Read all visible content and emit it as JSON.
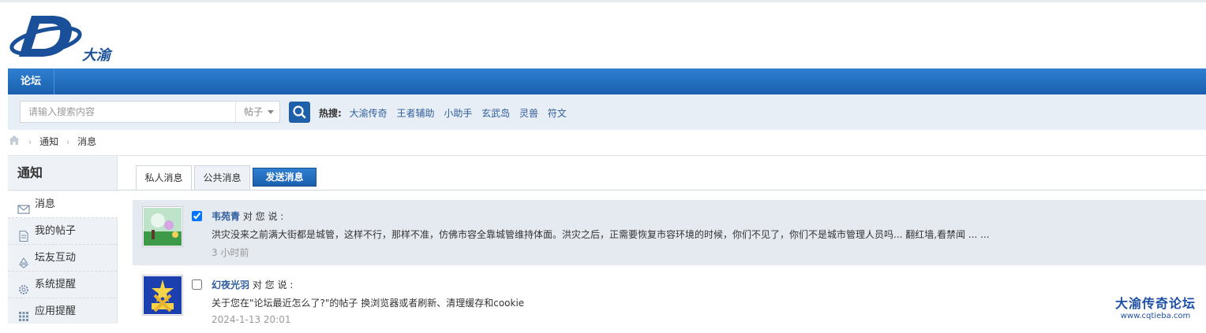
{
  "site": {
    "logo_text": "大渝"
  },
  "nav": {
    "items": [
      {
        "label": "论坛"
      }
    ]
  },
  "search": {
    "placeholder": "请输入搜索内容",
    "type_selected": "帖子",
    "hot_label": "热搜:",
    "hot_terms": [
      "大渝传奇",
      "王者辅助",
      "小助手",
      "玄武岛",
      "灵兽",
      "符文"
    ]
  },
  "breadcrumb": {
    "items": [
      "通知",
      "消息"
    ]
  },
  "sidebar": {
    "title": "通知",
    "items": [
      {
        "label": "消息",
        "icon": "envelope-icon",
        "active": true
      },
      {
        "label": "我的帖子",
        "icon": "document-icon"
      },
      {
        "label": "坛友互动",
        "icon": "recycle-icon"
      },
      {
        "label": "系统提醒",
        "icon": "gear-icon"
      },
      {
        "label": "应用提醒",
        "icon": "grid-icon"
      }
    ]
  },
  "tabs": {
    "private": "私人消息",
    "public": "公共消息",
    "send": "发送消息"
  },
  "messages": [
    {
      "sender": "韦苑青",
      "action": "对 您 说 :",
      "text": "洪灾没来之前满大街都是城管，这样不行，那样不准，仿佛市容全靠城管维持体面。洪灾之后，正需要恢复市容环境的时候，你们不见了，你们不是城市管理人员吗... 翻红墙,看禁闻 ... ...",
      "time": "3 小时前",
      "checked": true
    },
    {
      "sender": "幻夜光羽",
      "action": "对 您 说 :",
      "text": "关于您在\"论坛最近怎么了?\"的帖子 换浏览器或者刷新、清理缓存和cookie",
      "time": "2024-1-13 20:01",
      "checked": false
    }
  ],
  "watermark": {
    "title": "大渝传奇论坛",
    "url": "www.cqtieba.com"
  },
  "colors": {
    "nav_blue": "#1b5fae",
    "link": "#2f5e9c",
    "sidebar_bg": "#eef2f7"
  }
}
